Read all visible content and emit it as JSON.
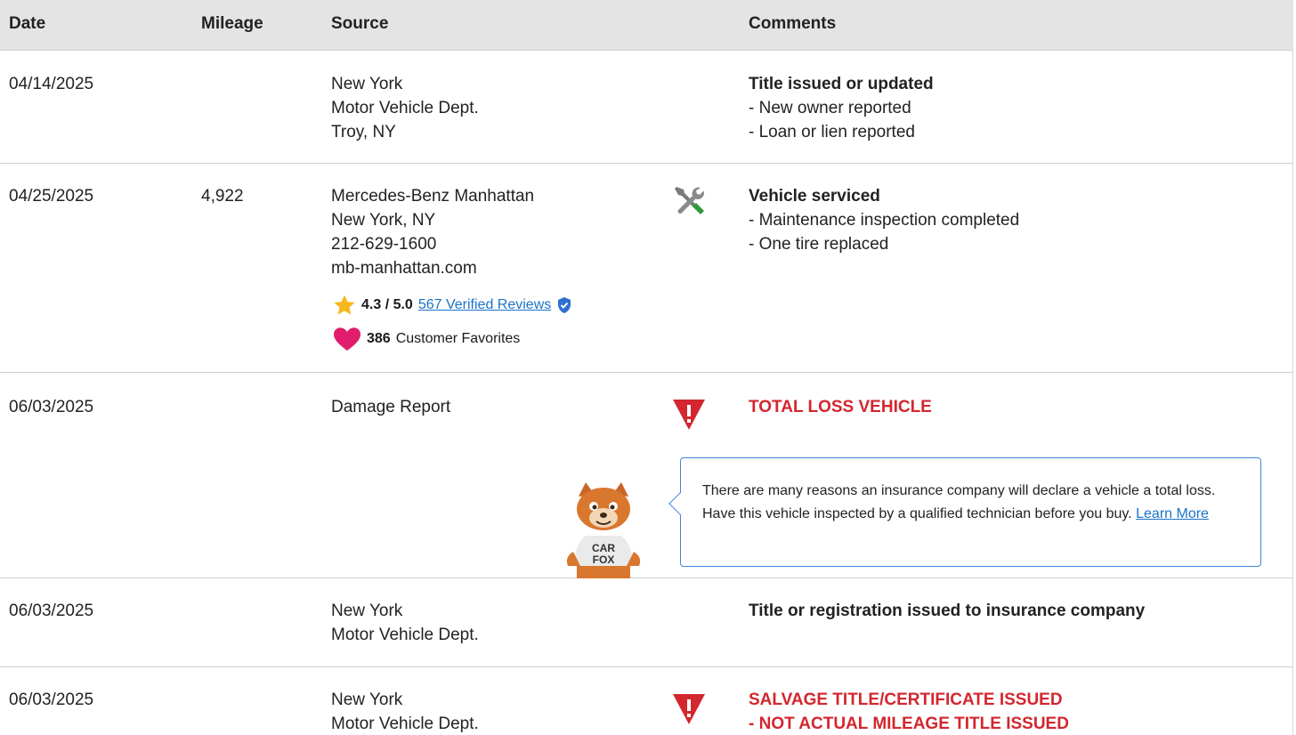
{
  "header": {
    "date": "Date",
    "mileage": "Mileage",
    "source": "Source",
    "comments": "Comments"
  },
  "rows": [
    {
      "date": "04/14/2025",
      "mileage": "",
      "source": [
        "New York",
        "Motor Vehicle Dept.",
        "Troy, NY"
      ],
      "icon": "",
      "comment_title": "Title issued or updated",
      "comment_lines": [
        "- New owner reported",
        "- Loan or lien reported"
      ]
    },
    {
      "date": "04/25/2025",
      "mileage": "4,922",
      "source": [
        "Mercedes-Benz Manhattan",
        "New York, NY",
        "212-629-1600",
        "mb-manhattan.com"
      ],
      "rating": {
        "score": "4.3 / 5.0",
        "reviews_link": "567 Verified Reviews",
        "favorites_count": "386",
        "favorites_label": "Customer Favorites"
      },
      "icon": "wrench-screwdriver-icon",
      "comment_title": "Vehicle serviced",
      "comment_lines": [
        "- Maintenance inspection completed",
        "- One tire replaced"
      ]
    },
    {
      "date": "06/03/2025",
      "mileage": "",
      "source": [
        "Damage Report"
      ],
      "icon": "warning-shield-icon",
      "comment_title": "TOTAL LOSS VEHICLE",
      "tooltip": {
        "text": "There are many reasons an insurance company will declare a vehicle a total loss. Have this vehicle inspected by a qualified technician before you buy.",
        "link": "Learn More"
      },
      "mascot_text": [
        "CAR",
        "FOX"
      ]
    },
    {
      "date": "06/03/2025",
      "mileage": "",
      "source": [
        "New York",
        "Motor Vehicle Dept."
      ],
      "icon": "",
      "comment_title": "Title or registration issued to insurance company",
      "comment_lines": []
    },
    {
      "date": "06/03/2025",
      "mileage": "",
      "source": [
        "New York",
        "Motor Vehicle Dept."
      ],
      "icon": "warning-shield-icon",
      "comment_title": "SALVAGE TITLE/CERTIFICATE ISSUED",
      "comment_lines": [
        "- NOT ACTUAL MILEAGE TITLE ISSUED"
      ]
    }
  ],
  "colors": {
    "accent_red": "#d3262e",
    "link_blue": "#1a73c9",
    "header_bg": "#e4e4e4"
  }
}
